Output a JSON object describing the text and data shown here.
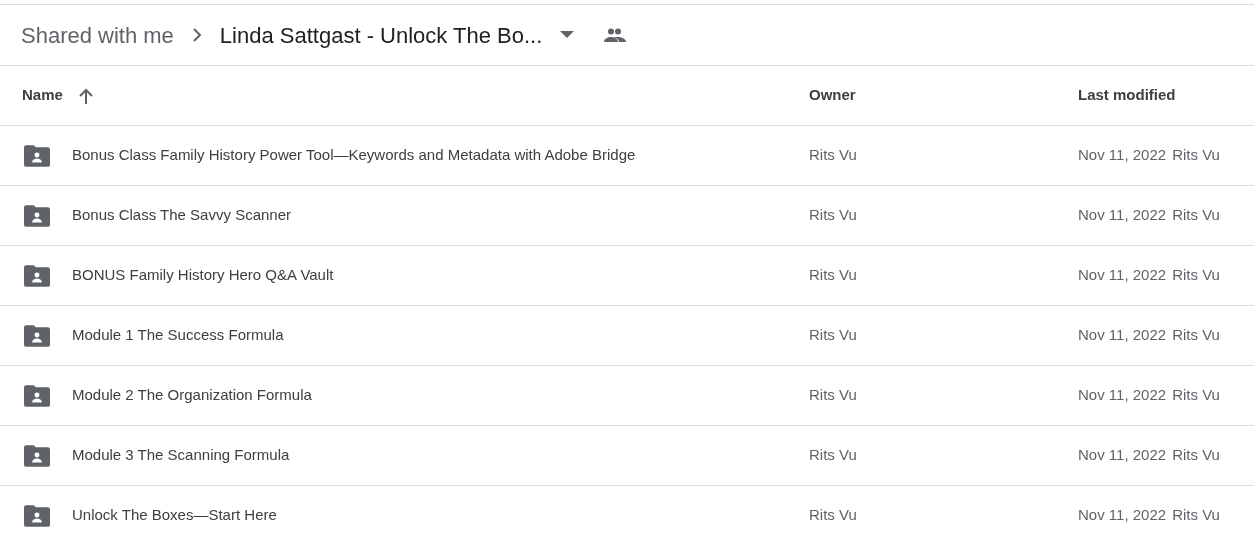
{
  "breadcrumb": {
    "parent": "Shared with me",
    "current": "Linda Sattgast - Unlock The Bo..."
  },
  "table": {
    "columns": [
      {
        "label": "Name"
      },
      {
        "label": "Owner"
      },
      {
        "label": "Last modified"
      }
    ],
    "rows": [
      {
        "name": "Bonus Class Family History Power Tool—Keywords and Metadata with Adobe Bridge",
        "owner": "Rits Vu",
        "modified": "Nov 11, 2022",
        "modified_by": "Rits Vu"
      },
      {
        "name": "Bonus Class The Savvy Scanner",
        "owner": "Rits Vu",
        "modified": "Nov 11, 2022",
        "modified_by": "Rits Vu"
      },
      {
        "name": "BONUS Family History Hero Q&A Vault",
        "owner": "Rits Vu",
        "modified": "Nov 11, 2022",
        "modified_by": "Rits Vu"
      },
      {
        "name": "Module 1 The Success Formula",
        "owner": "Rits Vu",
        "modified": "Nov 11, 2022",
        "modified_by": "Rits Vu"
      },
      {
        "name": "Module 2 The Organization Formula",
        "owner": "Rits Vu",
        "modified": "Nov 11, 2022",
        "modified_by": "Rits Vu"
      },
      {
        "name": "Module 3 The Scanning Formula",
        "owner": "Rits Vu",
        "modified": "Nov 11, 2022",
        "modified_by": "Rits Vu"
      },
      {
        "name": "Unlock The Boxes—Start Here",
        "owner": "Rits Vu",
        "modified": "Nov 11, 2022",
        "modified_by": "Rits Vu"
      }
    ]
  }
}
